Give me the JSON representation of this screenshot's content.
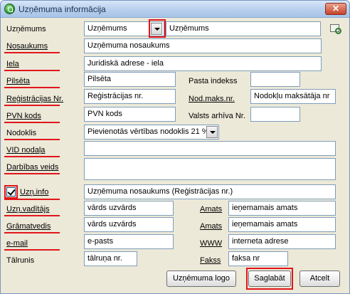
{
  "window": {
    "title": "Uzņēmuma informācija",
    "close_glyph": "✕"
  },
  "form": {
    "uznemums": {
      "label": "Uzņēmums",
      "select_value": "Uzņēmums",
      "value": "Uzņēmums"
    },
    "nosaukums": {
      "label": "Nosaukums",
      "value": "Uzņēmuma nosaukums"
    },
    "iela": {
      "label": "Iela",
      "value": "Juridiskā adrese - iela"
    },
    "pilseta": {
      "label": "Pilsēta",
      "value": "Pilsēta"
    },
    "pasta_indekss": {
      "label": "Pasta indekss",
      "value": ""
    },
    "registracijas_nr": {
      "label": "Reģistrācijas Nr.",
      "value": "Reģistrācijas nr."
    },
    "nod_maks_nr": {
      "label": "Nod.maks.nr.",
      "value": "Nodokļu maksātāja nr"
    },
    "pvn_kods": {
      "label": "PVN kods",
      "value": "PVN kods"
    },
    "valsts_arhiva_nr": {
      "label": "Valsts arhīva Nr.",
      "value": ""
    },
    "nodoklis": {
      "label": "Nodoklis",
      "value": "Pievienotās vērtības nodoklis 21 %"
    },
    "vid_nodala": {
      "label": "VID nodaļa",
      "value": ""
    },
    "darbibas_veids": {
      "label": "Darbības veids",
      "value": ""
    },
    "uzn_info": {
      "label": "Uzņ.info",
      "checked": true,
      "value": "Uzņēmuma nosaukums (Reģistrācijas nr.)"
    },
    "uzn_vaditajs": {
      "label": "Uzņ.vadītājs",
      "value": "vārds uzvārds",
      "amats_label": "Amats",
      "amats_value": "ieņemamais amats"
    },
    "gramatvedis": {
      "label": "Grāmatvedis",
      "value": "vārds uzvārds",
      "amats_label": "Amats",
      "amats_value": "ieņemamais amats"
    },
    "email": {
      "label": "e-mail",
      "value": "e-pasts",
      "www_label": "WWW",
      "www_value": "interneta adrese"
    },
    "talrunis": {
      "label": "Tālrunis",
      "value": "tālruņa nr.",
      "fakss_label": "Fakss",
      "fakss_value": "faksa nr"
    }
  },
  "buttons": {
    "logo": "Uzņēmuma logo",
    "save": "Saglabāt",
    "cancel": "Atcelt"
  },
  "colors": {
    "highlight": "#e2151b",
    "window_bg": "#ece9d8",
    "title_blue": "#bcd3ef"
  },
  "icons": [
    "app-icon",
    "close-icon",
    "dropdown-arrow-icon",
    "search-icon",
    "checkbox-checked-icon"
  ]
}
